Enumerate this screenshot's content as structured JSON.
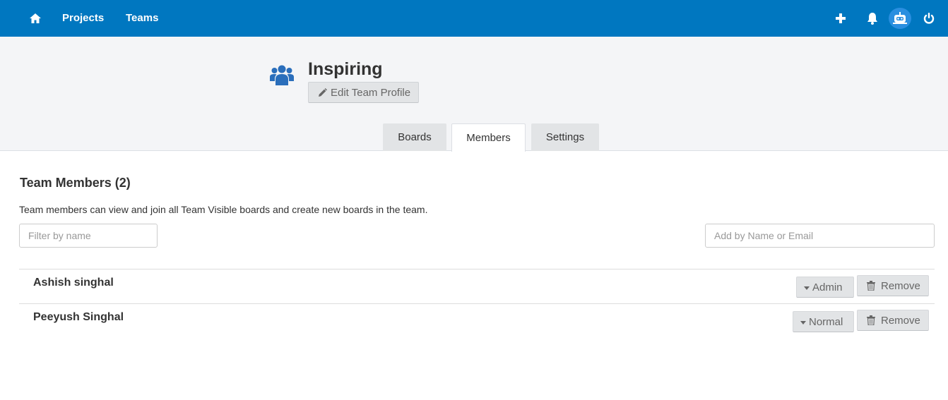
{
  "nav": {
    "projects_label": "Projects",
    "teams_label": "Teams",
    "icons": [
      "home-icon",
      "plus-icon",
      "bell-icon",
      "avatar",
      "power-icon"
    ],
    "bar_color": "#0077c0"
  },
  "team": {
    "name": "Inspiring",
    "edit_label": "Edit Team Profile",
    "icon": "team-icon",
    "icon_color": "#2a6ebb"
  },
  "tabs": [
    {
      "label": "Boards",
      "active": false
    },
    {
      "label": "Members",
      "active": true
    },
    {
      "label": "Settings",
      "active": false
    }
  ],
  "members_section": {
    "title": "Team Members (2)",
    "description": "Team members can view and join all Team Visible boards and create new boards in the team.",
    "filter_placeholder": "Filter by name",
    "add_placeholder": "Add by Name or Email"
  },
  "members": [
    {
      "name": "Ashish singhal",
      "role": "Admin",
      "remove_label": "Remove"
    },
    {
      "name": "Peeyush Singhal",
      "role": "Normal",
      "remove_label": "Remove"
    }
  ]
}
